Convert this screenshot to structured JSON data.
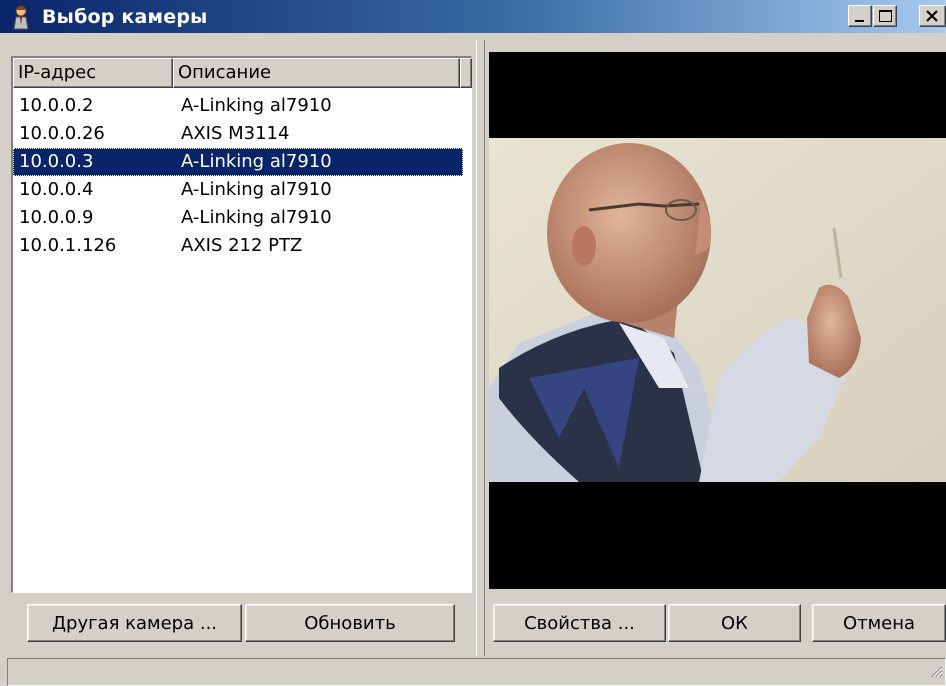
{
  "window": {
    "title": "Выбор камеры",
    "icon": "user-camera-icon"
  },
  "list": {
    "columns": [
      "IP-адрес",
      "Описание"
    ],
    "rows": [
      {
        "ip": "10.0.0.2",
        "desc": "A-Linking al7910",
        "selected": false
      },
      {
        "ip": "10.0.0.26",
        "desc": "AXIS M3114",
        "selected": false
      },
      {
        "ip": "10.0.0.3",
        "desc": "A-Linking al7910",
        "selected": true
      },
      {
        "ip": "10.0.0.4",
        "desc": "A-Linking al7910",
        "selected": false
      },
      {
        "ip": "10.0.0.9",
        "desc": "A-Linking al7910",
        "selected": false
      },
      {
        "ip": "10.0.1.126",
        "desc": "AXIS 212 PTZ",
        "selected": false
      }
    ]
  },
  "buttons": {
    "other_camera": "Другая камера ...",
    "refresh": "Обновить",
    "properties": "Свойства ...",
    "ok": "ОК",
    "cancel": "Отмена"
  },
  "colors": {
    "selection": "#0a246a",
    "titlebar_start": "#0a246a",
    "titlebar_end": "#a6caf0",
    "face": "#d4d0c8"
  }
}
